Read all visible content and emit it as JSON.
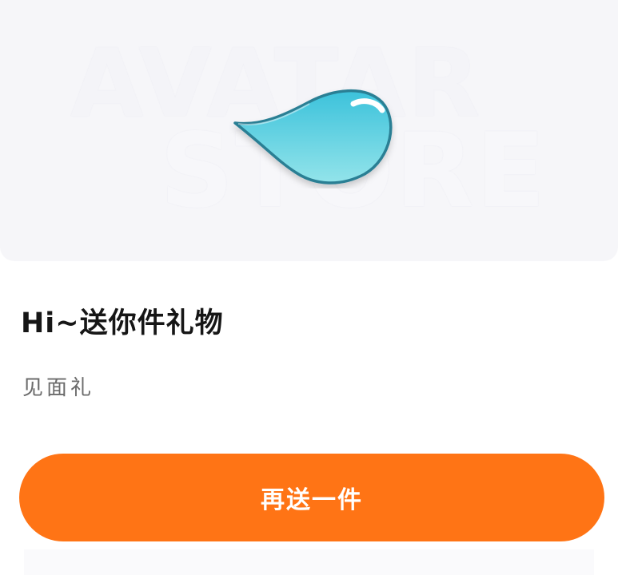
{
  "hero": {
    "watermark_line1": "AVATAR",
    "watermark_line2": "STORE",
    "gift_icon": "water-drop-icon"
  },
  "gift": {
    "title": "Hi~送你件礼物",
    "subtitle": "见面礼"
  },
  "action": {
    "button_label": "再送一件"
  },
  "colors": {
    "accent": "#ff7415",
    "hero_bg": "#f6f6f9",
    "title_text": "#161616",
    "subtitle_text": "#6b6b6b",
    "drop_top": "#3fc4dc",
    "drop_bottom": "#8fe3ea"
  }
}
